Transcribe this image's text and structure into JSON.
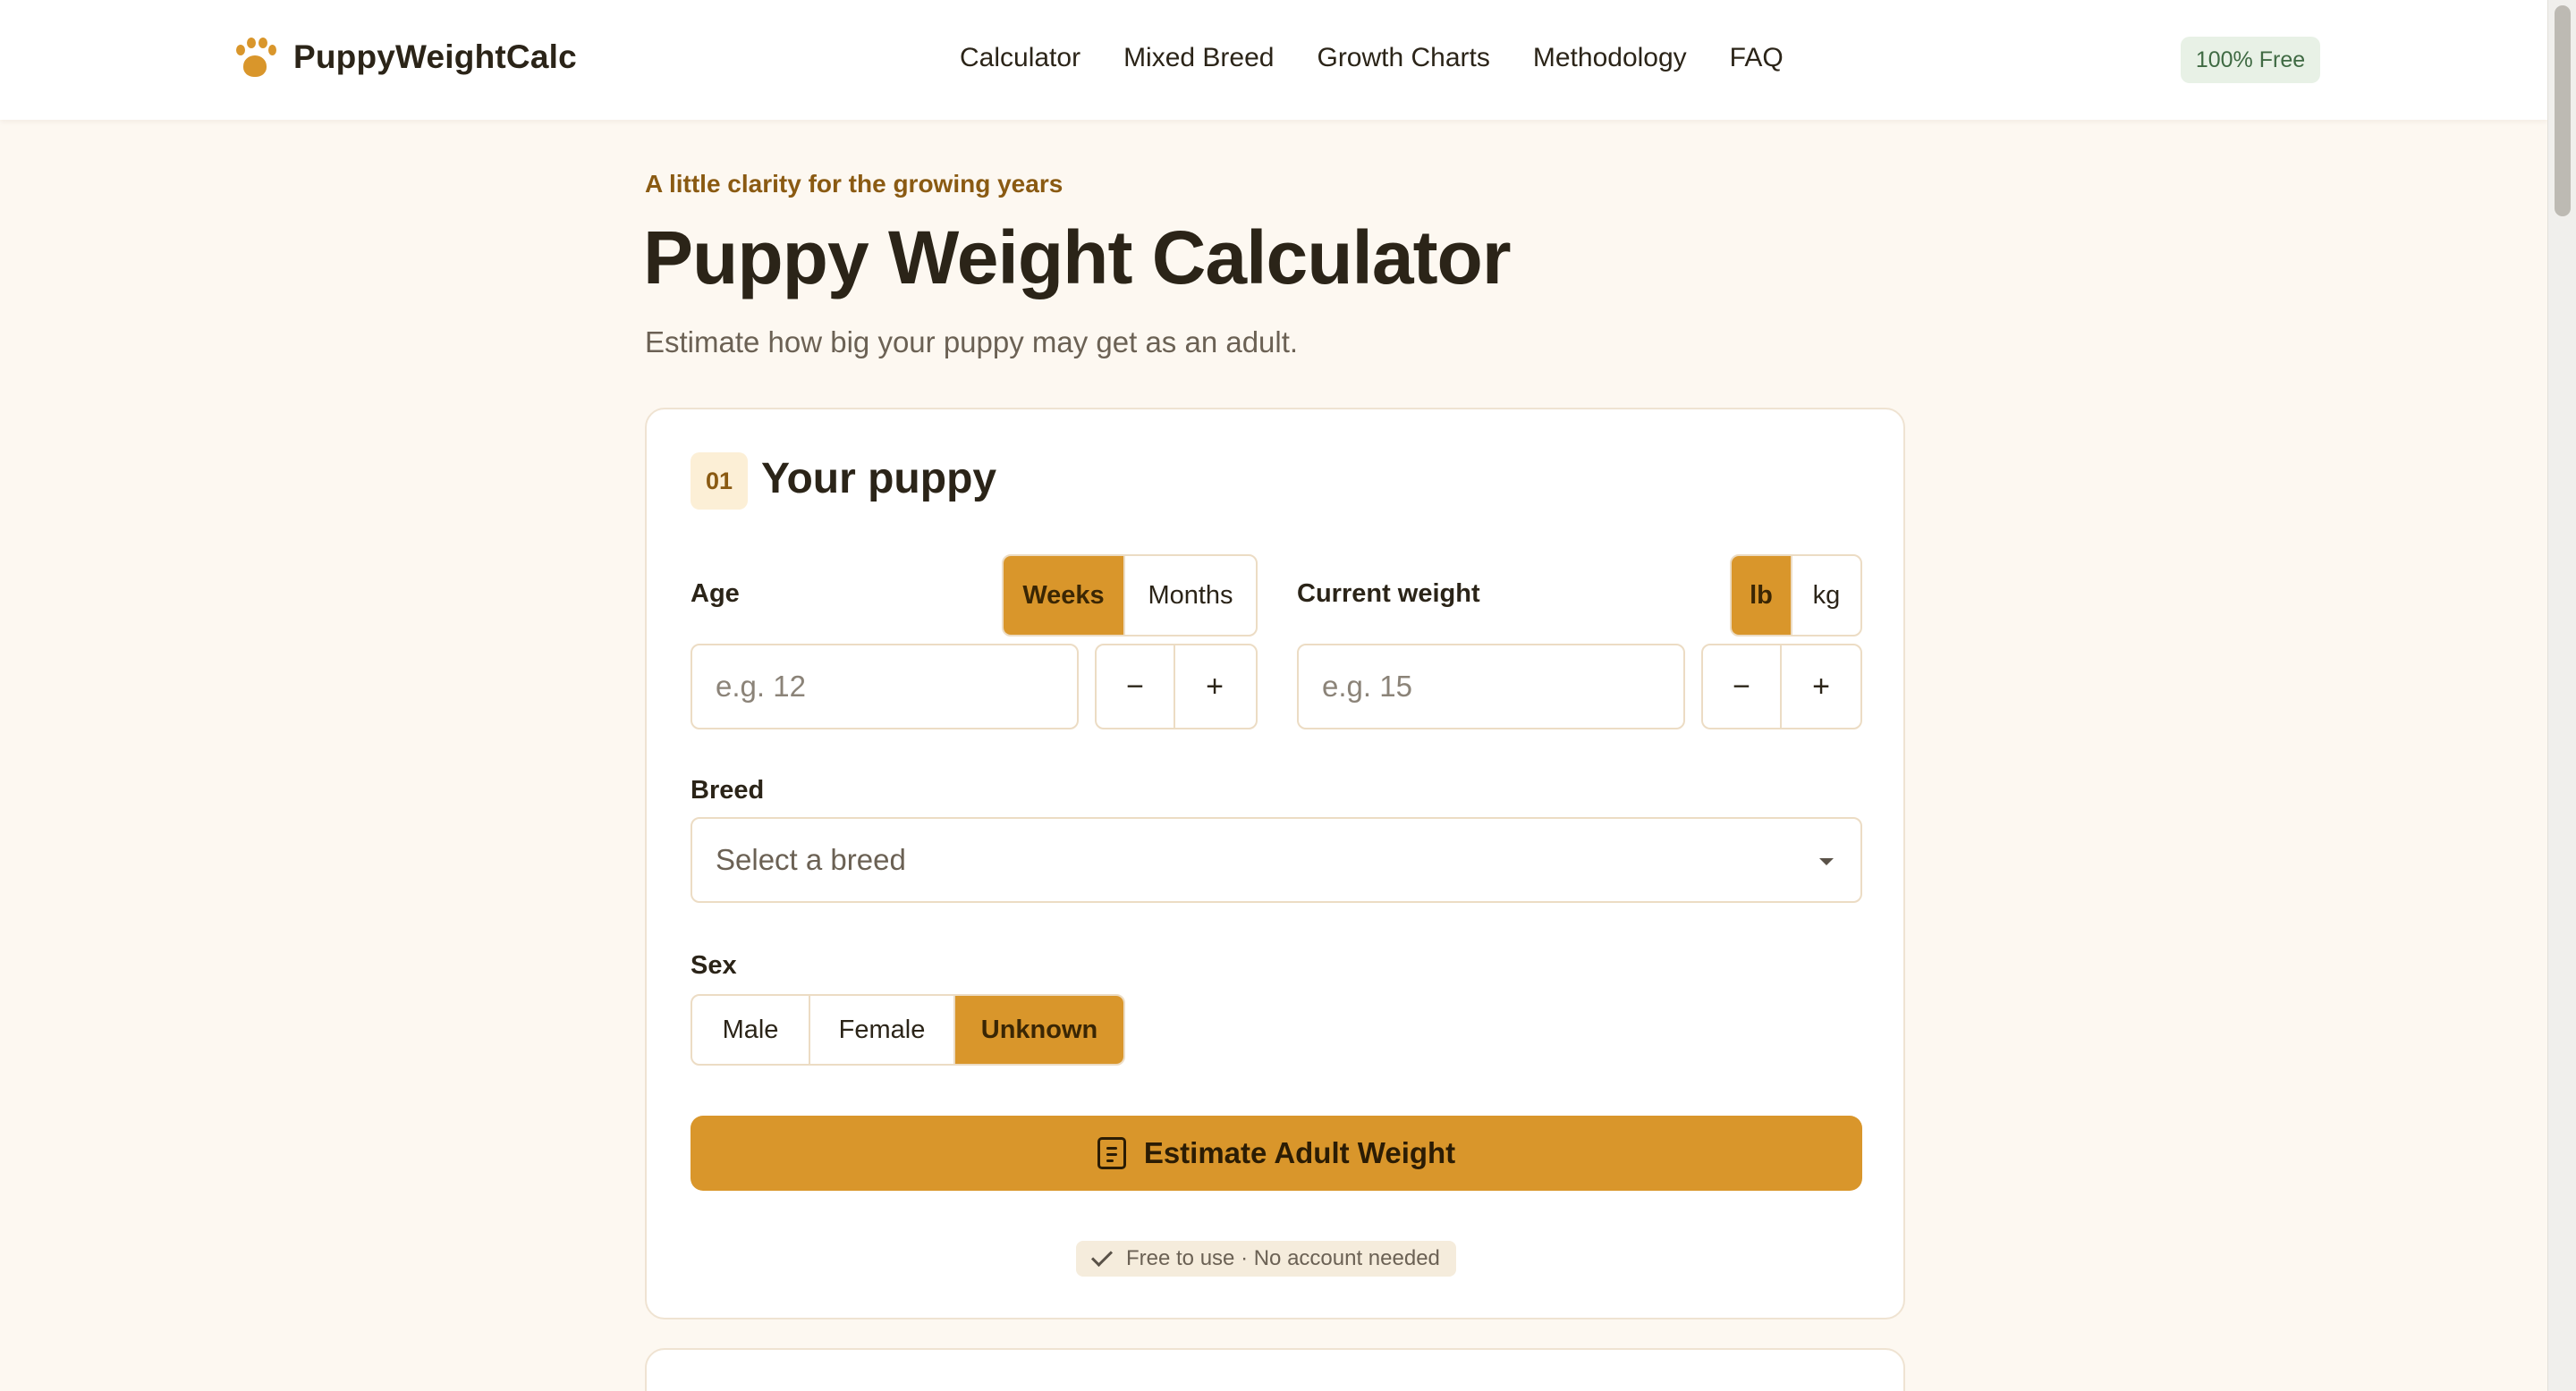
{
  "brand": {
    "name": "PuppyWeightCalc"
  },
  "nav": {
    "items": [
      "Calculator",
      "Mixed Breed",
      "Growth Charts",
      "Methodology",
      "FAQ"
    ]
  },
  "badge": {
    "label": "100% Free"
  },
  "hero": {
    "eyebrow": "A little clarity for the growing years",
    "title": "Puppy Weight Calculator",
    "subtitle": "Estimate how big your puppy may get as an adult."
  },
  "form": {
    "step_number": "01",
    "step_title": "Your puppy",
    "age": {
      "label": "Age",
      "units": [
        "Weeks",
        "Months"
      ],
      "selected_unit": "Weeks",
      "placeholder": "e.g. 12",
      "value": ""
    },
    "weight": {
      "label": "Current weight",
      "units": [
        "lb",
        "kg"
      ],
      "selected_unit": "lb",
      "placeholder": "e.g. 15",
      "value": ""
    },
    "stepper": {
      "minus": "−",
      "plus": "+"
    },
    "breed": {
      "label": "Breed",
      "placeholder": "Select a breed"
    },
    "sex": {
      "label": "Sex",
      "options": [
        "Male",
        "Female",
        "Unknown"
      ],
      "selected": "Unknown"
    },
    "submit_label": "Estimate Adult Weight",
    "note": "Free to use · No account needed"
  },
  "colors": {
    "accent": "#d9962b",
    "background": "#fdf8f1",
    "badge_bg": "#e8f1e6",
    "badge_text": "#3f6a43"
  }
}
